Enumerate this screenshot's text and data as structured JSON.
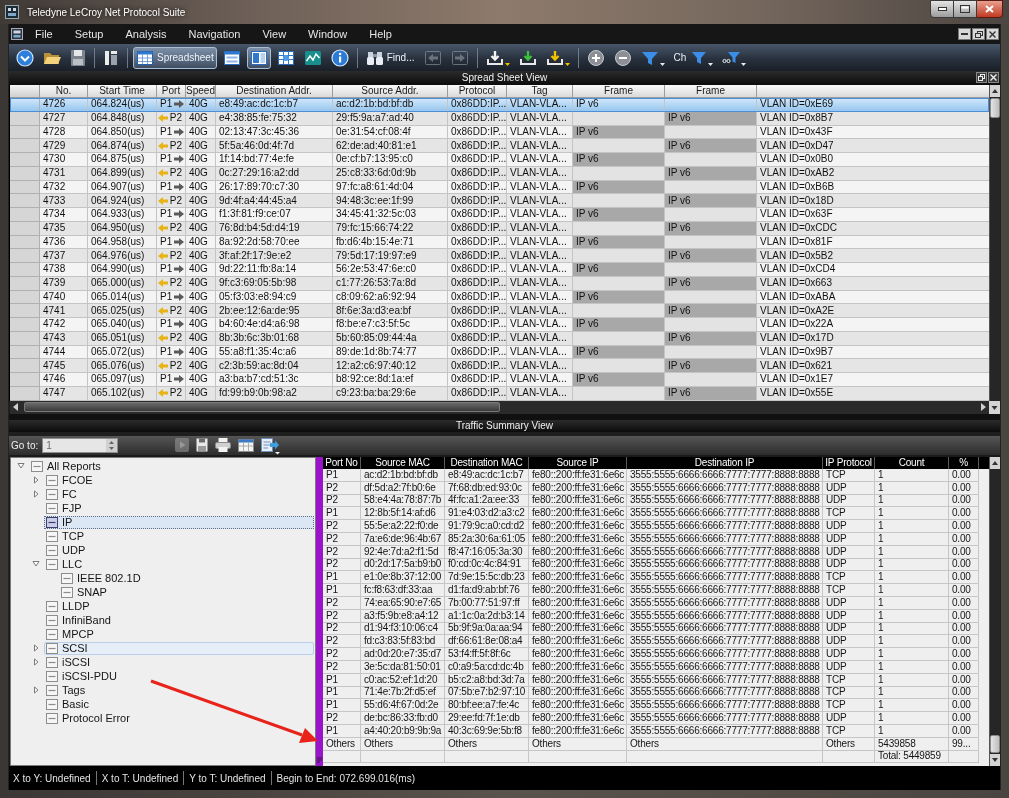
{
  "window": {
    "title": "Teledyne LeCroy Net Protocol Suite"
  },
  "menu": [
    "File",
    "Setup",
    "Analysis",
    "Navigation",
    "View",
    "Window",
    "Help"
  ],
  "toolbar": [
    {
      "items": [
        {
          "kind": "dropdown",
          "selected": false,
          "disabled": false
        },
        {
          "kind": "open",
          "selected": false,
          "disabled": false
        },
        {
          "kind": "save",
          "selected": false,
          "disabled": false
        }
      ]
    },
    {
      "items": [
        {
          "kind": "tools",
          "selected": false,
          "disabled": false
        }
      ]
    },
    {
      "items": [
        {
          "kind": "spreadsheet",
          "label": "Spreadsheet",
          "selected": true,
          "disabled": false
        },
        {
          "kind": "window",
          "selected": false,
          "disabled": false
        },
        {
          "kind": "split",
          "selected": true,
          "disabled": false
        },
        {
          "kind": "grid",
          "selected": false,
          "disabled": false
        },
        {
          "kind": "chart",
          "selected": false,
          "disabled": false
        },
        {
          "kind": "info",
          "selected": false,
          "disabled": false
        }
      ]
    },
    {
      "items": [
        {
          "kind": "find",
          "label": "Find...",
          "selected": false,
          "disabled": false
        },
        {
          "kind": "back",
          "selected": false,
          "disabled": true
        },
        {
          "kind": "forward",
          "selected": false,
          "disabled": true
        }
      ]
    },
    {
      "items": [
        {
          "kind": "export",
          "selected": false,
          "disabled": false
        },
        {
          "kind": "import",
          "selected": false,
          "disabled": false
        },
        {
          "kind": "mark",
          "selected": false,
          "disabled": false
        }
      ]
    },
    {
      "items": [
        {
          "kind": "zoomin",
          "selected": false,
          "disabled": false
        },
        {
          "kind": "zoomout",
          "selected": false,
          "disabled": false
        },
        {
          "kind": "filter",
          "selected": false,
          "disabled": false
        },
        {
          "kind": "labelfilter",
          "label": "Ch",
          "selected": false,
          "disabled": false
        },
        {
          "kind": "dotfilter",
          "selected": false,
          "disabled": false
        }
      ]
    }
  ],
  "spreadsheet": {
    "title": "Spread Sheet View",
    "columns": [
      "No.",
      "Start Time",
      "Port",
      "Speed",
      "Destination Addr.",
      "Source Addr.",
      "Protocol",
      "Tag",
      "Frame",
      "Frame"
    ],
    "rows": [
      {
        "no": "4726",
        "start_time": "064.824(us)",
        "port": "P1",
        "outbound": true,
        "speed": "40G",
        "destination": "e8:49:ac:dc:1c:b7",
        "source": "ac:d2:1b:bd:bf:db",
        "protocol": "0x86DD:IP...",
        "tag": "VLAN-VLA...",
        "frame_1": "IP v6",
        "column_12": "VLAN ID=0xE69",
        "selected": true
      },
      {
        "no": "4727",
        "start_time": "064.848(us)",
        "port": "P2",
        "outbound": false,
        "speed": "40G",
        "destination": "e4:38:85:fe:75:32",
        "source": "29:f5:9a:a7:ad:40",
        "protocol": "0x86DD:IP...",
        "tag": "VLAN-VLA...",
        "frame_2": "IP v6",
        "column_12": "VLAN ID=0x8B7",
        "selected": false
      },
      {
        "no": "4728",
        "start_time": "064.850(us)",
        "port": "P1",
        "outbound": true,
        "speed": "40G",
        "destination": "02:13:47:3c:45:36",
        "source": "0e:31:54:cf:08:4f",
        "protocol": "0x86DD:IP...",
        "tag": "VLAN-VLA...",
        "frame_1": "IP v6",
        "column_12": "VLAN ID=0x43F",
        "selected": false
      },
      {
        "no": "4729",
        "start_time": "064.874(us)",
        "port": "P2",
        "outbound": false,
        "speed": "40G",
        "destination": "5f:5a:46:0d:4f:7d",
        "source": "62:de:ad:40:81:e1",
        "protocol": "0x86DD:IP...",
        "tag": "VLAN-VLA...",
        "frame_2": "IP v6",
        "column_12": "VLAN ID=0xD47",
        "selected": false
      },
      {
        "no": "4730",
        "start_time": "064.875(us)",
        "port": "P1",
        "outbound": true,
        "speed": "40G",
        "destination": "1f:14:bd:77:4e:fe",
        "source": "0e:cf:b7:13:95:c0",
        "protocol": "0x86DD:IP...",
        "tag": "VLAN-VLA...",
        "frame_1": "IP v6",
        "column_12": "VLAN ID=0x0B0",
        "selected": false
      },
      {
        "no": "4731",
        "start_time": "064.899(us)",
        "port": "P2",
        "outbound": false,
        "speed": "40G",
        "destination": "0c:27:29:16:a2:dd",
        "source": "25:c8:33:6d:0d:9b",
        "protocol": "0x86DD:IP...",
        "tag": "VLAN-VLA...",
        "frame_2": "IP v6",
        "column_12": "VLAN ID=0xAB2",
        "selected": false
      },
      {
        "no": "4732",
        "start_time": "064.907(us)",
        "port": "P1",
        "outbound": true,
        "speed": "40G",
        "destination": "26:17:89:70:c7:30",
        "source": "97:fc:a8:61:4d:04",
        "protocol": "0x86DD:IP...",
        "tag": "VLAN-VLA...",
        "frame_1": "IP v6",
        "column_12": "VLAN ID=0xB6B",
        "selected": false
      },
      {
        "no": "4733",
        "start_time": "064.924(us)",
        "port": "P2",
        "outbound": false,
        "speed": "40G",
        "destination": "9d:4f:a4:44:45:a4",
        "source": "94:48:3c:ee:1f:99",
        "protocol": "0x86DD:IP...",
        "tag": "VLAN-VLA...",
        "frame_2": "IP v6",
        "column_12": "VLAN ID=0x18D",
        "selected": false
      },
      {
        "no": "4734",
        "start_time": "064.933(us)",
        "port": "P1",
        "outbound": true,
        "speed": "40G",
        "destination": "f1:3f:81:f9:ce:07",
        "source": "34:45:41:32:5c:03",
        "protocol": "0x86DD:IP...",
        "tag": "VLAN-VLA...",
        "frame_1": "IP v6",
        "column_12": "VLAN ID=0x63F",
        "selected": false
      },
      {
        "no": "4735",
        "start_time": "064.950(us)",
        "port": "P2",
        "outbound": false,
        "speed": "40G",
        "destination": "76:8d:b4:5d:d4:19",
        "source": "79:fc:15:66:74:22",
        "protocol": "0x86DD:IP...",
        "tag": "VLAN-VLA...",
        "frame_2": "IP v6",
        "column_12": "VLAN ID=0xCDC",
        "selected": false
      },
      {
        "no": "4736",
        "start_time": "064.958(us)",
        "port": "P1",
        "outbound": true,
        "speed": "40G",
        "destination": "8a:92:2d:58:70:ee",
        "source": "fb:d6:4b:15:4e:71",
        "protocol": "0x86DD:IP...",
        "tag": "VLAN-VLA...",
        "frame_1": "IP v6",
        "column_12": "VLAN ID=0x81F",
        "selected": false
      },
      {
        "no": "4737",
        "start_time": "064.976(us)",
        "port": "P2",
        "outbound": false,
        "speed": "40G",
        "destination": "3f:af:2f:17:9e:e2",
        "source": "79:5d:17:19:97:e9",
        "protocol": "0x86DD:IP...",
        "tag": "VLAN-VLA...",
        "frame_2": "IP v6",
        "column_12": "VLAN ID=0x5B2",
        "selected": false
      },
      {
        "no": "4738",
        "start_time": "064.990(us)",
        "port": "P1",
        "outbound": true,
        "speed": "40G",
        "destination": "9d:22:11:fb:8a:14",
        "source": "56:2e:53:47:6e:c0",
        "protocol": "0x86DD:IP...",
        "tag": "VLAN-VLA...",
        "frame_1": "IP v6",
        "column_12": "VLAN ID=0xCD4",
        "selected": false
      },
      {
        "no": "4739",
        "start_time": "065.000(us)",
        "port": "P2",
        "outbound": false,
        "speed": "40G",
        "destination": "9f:c3:69:05:5b:98",
        "source": "c1:77:26:53:7a:8d",
        "protocol": "0x86DD:IP...",
        "tag": "VLAN-VLA...",
        "frame_2": "IP v6",
        "column_12": "VLAN ID=0x663",
        "selected": false
      },
      {
        "no": "4740",
        "start_time": "065.014(us)",
        "port": "P1",
        "outbound": true,
        "speed": "40G",
        "destination": "05:f3:03:e8:94:c9",
        "source": "c8:09:62:a6:92:94",
        "protocol": "0x86DD:IP...",
        "tag": "VLAN-VLA...",
        "frame_1": "IP v6",
        "column_12": "VLAN ID=0xABA",
        "selected": false
      },
      {
        "no": "4741",
        "start_time": "065.025(us)",
        "port": "P2",
        "outbound": false,
        "speed": "40G",
        "destination": "2b:ee:12:6a:de:95",
        "source": "8f:6e:3a:d3:ea:bf",
        "protocol": "0x86DD:IP...",
        "tag": "VLAN-VLA...",
        "frame_2": "IP v6",
        "column_12": "VLAN ID=0xA2E",
        "selected": false
      },
      {
        "no": "4742",
        "start_time": "065.040(us)",
        "port": "P1",
        "outbound": true,
        "speed": "40G",
        "destination": "b4:60:4e:d4:a6:98",
        "source": "f8:be:e7:c3:5f:5c",
        "protocol": "0x86DD:IP...",
        "tag": "VLAN-VLA...",
        "frame_1": "IP v6",
        "column_12": "VLAN ID=0x22A",
        "selected": false
      },
      {
        "no": "4743",
        "start_time": "065.051(us)",
        "port": "P2",
        "outbound": false,
        "speed": "40G",
        "destination": "8b:3b:6c:3b:01:68",
        "source": "5b:60:85:09:44:4a",
        "protocol": "0x86DD:IP...",
        "tag": "VLAN-VLA...",
        "frame_2": "IP v6",
        "column_12": "VLAN ID=0x17D",
        "selected": false
      },
      {
        "no": "4744",
        "start_time": "065.072(us)",
        "port": "P1",
        "outbound": true,
        "speed": "40G",
        "destination": "55:a8:f1:35:4c:a6",
        "source": "89:de:1d:8b:74:77",
        "protocol": "0x86DD:IP...",
        "tag": "VLAN-VLA...",
        "frame_1": "IP v6",
        "column_12": "VLAN ID=0x9B7",
        "selected": false
      },
      {
        "no": "4745",
        "start_time": "065.076(us)",
        "port": "P2",
        "outbound": false,
        "speed": "40G",
        "destination": "c2:3b:59:ac:8d:04",
        "source": "12:a2:c6:97:40:12",
        "protocol": "0x86DD:IP...",
        "tag": "VLAN-VLA...",
        "frame_2": "IP v6",
        "column_12": "VLAN ID=0x621",
        "selected": false
      },
      {
        "no": "4746",
        "start_time": "065.097(us)",
        "port": "P1",
        "outbound": true,
        "speed": "40G",
        "destination": "a3:ba:b7:cd:51:3c",
        "source": "b8:92:ce:8d:1a:ef",
        "protocol": "0x86DD:IP...",
        "tag": "VLAN-VLA...",
        "frame_1": "IP v6",
        "column_12": "VLAN ID=0x1E7",
        "selected": false
      },
      {
        "no": "4747",
        "start_time": "065.102(us)",
        "port": "P2",
        "outbound": false,
        "speed": "40G",
        "destination": "fd:99:b9:0b:98:a2",
        "source": "c9:23:ba:ba:29:6e",
        "protocol": "0x86DD:IP...",
        "tag": "VLAN-VLA...",
        "frame_2": "IP v6",
        "column_12": "VLAN ID=0x55E",
        "selected": false
      }
    ]
  },
  "traffic_summary": {
    "title": "Traffic Summary View",
    "goto": {
      "label": "Go to:",
      "value": "1"
    },
    "toolbar": [
      {
        "kind": "run",
        "disabled": true
      },
      {
        "kind": "save",
        "disabled": false
      },
      {
        "kind": "print",
        "disabled": false
      },
      {
        "kind": "table",
        "disabled": false
      },
      {
        "kind": "export",
        "disabled": false
      }
    ],
    "tree": [
      {
        "label": "All Reports",
        "expanded": true,
        "selected": false,
        "hovered": false,
        "children": [
          {
            "label": "FCOE",
            "expanded": false,
            "selected": false,
            "hovered": false
          },
          {
            "label": "FC",
            "expanded": false,
            "selected": false,
            "hovered": false
          },
          {
            "label": "FJP",
            "selected": false,
            "hovered": false
          },
          {
            "label": "IP",
            "selected": true,
            "hovered": false
          },
          {
            "label": "TCP",
            "selected": false,
            "hovered": false
          },
          {
            "label": "UDP",
            "selected": false,
            "hovered": false
          },
          {
            "label": "LLC",
            "expanded": true,
            "selected": false,
            "hovered": false,
            "children": [
              {
                "label": "IEEE 802.1D",
                "selected": false,
                "hovered": false
              },
              {
                "label": "SNAP",
                "selected": false,
                "hovered": false
              }
            ]
          },
          {
            "label": "LLDP",
            "selected": false,
            "hovered": false
          },
          {
            "label": "InfiniBand",
            "selected": false,
            "hovered": false
          },
          {
            "label": "MPCP",
            "selected": false,
            "hovered": false
          },
          {
            "label": "SCSI",
            "expanded": false,
            "selected": false,
            "hovered": true
          },
          {
            "label": "iSCSI",
            "expanded": false,
            "selected": false,
            "hovered": false
          },
          {
            "label": "iSCSI-PDU",
            "selected": false,
            "hovered": false
          },
          {
            "label": "Tags",
            "expanded": false,
            "selected": false,
            "hovered": false
          },
          {
            "label": "Basic",
            "selected": false,
            "hovered": false
          },
          {
            "label": "Protocol Error",
            "selected": false,
            "hovered": false
          }
        ]
      }
    ],
    "table": {
      "columns": [
        "Port No",
        "Source MAC",
        "Destination MAC",
        "Source IP",
        "Destination IP",
        "IP Protocol",
        "Count",
        "%"
      ],
      "rows": [
        {
          "port_no": "P1",
          "source_mac": "ac:d2:1b:bd:bf:db",
          "destination_mac": "e8:49:ac:dc:1c:b7",
          "source_ip": "fe80::200:ff:fe31:6e6c",
          "destination_ip": "3555:5555:6666:6666:7777:7777:8888:8888",
          "ip_protocol": "TCP",
          "count": "1",
          "percent": "0.00"
        },
        {
          "port_no": "P2",
          "source_mac": "df:5d:a2:7f:b0:6e",
          "destination_mac": "7f:68:db:ed:93:0c",
          "source_ip": "fe80::200:ff:fe31:6e6c",
          "destination_ip": "3555:5555:6666:6666:7777:7777:8888:8888",
          "ip_protocol": "UDP",
          "count": "1",
          "percent": "0.00"
        },
        {
          "port_no": "P2",
          "source_mac": "58:e4:4a:78:87:7b",
          "destination_mac": "4f:fc:a1:2a:ee:33",
          "source_ip": "fe80::200:ff:fe31:6e6c",
          "destination_ip": "3555:5555:6666:6666:7777:7777:8888:8888",
          "ip_protocol": "UDP",
          "count": "1",
          "percent": "0.00"
        },
        {
          "port_no": "P1",
          "source_mac": "12:8b:5f:14:af:d6",
          "destination_mac": "91:e4:03:d2:a3:c2",
          "source_ip": "fe80::200:ff:fe31:6e6c",
          "destination_ip": "3555:5555:6666:6666:7777:7777:8888:8888",
          "ip_protocol": "TCP",
          "count": "1",
          "percent": "0.00"
        },
        {
          "port_no": "P2",
          "source_mac": "55:5e:a2:22:f0:de",
          "destination_mac": "91:79:9c:a0:cd:d2",
          "source_ip": "fe80::200:ff:fe31:6e6c",
          "destination_ip": "3555:5555:6666:6666:7777:7777:8888:8888",
          "ip_protocol": "UDP",
          "count": "1",
          "percent": "0.00"
        },
        {
          "port_no": "P2",
          "source_mac": "7a:e6:de:96:4b:67",
          "destination_mac": "85:2a:30:6a:61:05",
          "source_ip": "fe80::200:ff:fe31:6e6c",
          "destination_ip": "3555:5555:6666:6666:7777:7777:8888:8888",
          "ip_protocol": "UDP",
          "count": "1",
          "percent": "0.00"
        },
        {
          "port_no": "P2",
          "source_mac": "92:4e:7d:a2:f1:5d",
          "destination_mac": "f8:47:16:05:3a:30",
          "source_ip": "fe80::200:ff:fe31:6e6c",
          "destination_ip": "3555:5555:6666:6666:7777:7777:8888:8888",
          "ip_protocol": "UDP",
          "count": "1",
          "percent": "0.00"
        },
        {
          "port_no": "P2",
          "source_mac": "d0:2d:17:5a:b9:b0",
          "destination_mac": "f0:cd:0c:4c:84:91",
          "source_ip": "fe80::200:ff:fe31:6e6c",
          "destination_ip": "3555:5555:6666:6666:7777:7777:8888:8888",
          "ip_protocol": "UDP",
          "count": "1",
          "percent": "0.00"
        },
        {
          "port_no": "P1",
          "source_mac": "e1:0e:8b:37:12:00",
          "destination_mac": "7d:9e:15:5c:db:23",
          "source_ip": "fe80::200:ff:fe31:6e6c",
          "destination_ip": "3555:5555:6666:6666:7777:7777:8888:8888",
          "ip_protocol": "TCP",
          "count": "1",
          "percent": "0.00"
        },
        {
          "port_no": "P1",
          "source_mac": "fc:f8:63:df:33:aa",
          "destination_mac": "d1:fa:d9:ab:bf:76",
          "source_ip": "fe80::200:ff:fe31:6e6c",
          "destination_ip": "3555:5555:6666:6666:7777:7777:8888:8888",
          "ip_protocol": "TCP",
          "count": "1",
          "percent": "0.00"
        },
        {
          "port_no": "P2",
          "source_mac": "74:ea:65:90:e7:65",
          "destination_mac": "7b:00:77:51:97:ff",
          "source_ip": "fe80::200:ff:fe31:6e6c",
          "destination_ip": "3555:5555:6666:6666:7777:7777:8888:8888",
          "ip_protocol": "UDP",
          "count": "1",
          "percent": "0.00"
        },
        {
          "port_no": "P2",
          "source_mac": "a3:f5:9b:e8:a4:12",
          "destination_mac": "a1:1c:0a:2d:b3:14",
          "source_ip": "fe80::200:ff:fe31:6e6c",
          "destination_ip": "3555:5555:6666:6666:7777:7777:8888:8888",
          "ip_protocol": "UDP",
          "count": "1",
          "percent": "0.00"
        },
        {
          "port_no": "P2",
          "source_mac": "d1:94:f3:10:06:c4",
          "destination_mac": "5b:9f:9a:0a:aa:94",
          "source_ip": "fe80::200:ff:fe31:6e6c",
          "destination_ip": "3555:5555:6666:6666:7777:7777:8888:8888",
          "ip_protocol": "UDP",
          "count": "1",
          "percent": "0.00"
        },
        {
          "port_no": "P2",
          "source_mac": "fd:c3:83:5f:83:bd",
          "destination_mac": "df:66:61:8e:08:a4",
          "source_ip": "fe80::200:ff:fe31:6e6c",
          "destination_ip": "3555:5555:6666:6666:7777:7777:8888:8888",
          "ip_protocol": "UDP",
          "count": "1",
          "percent": "0.00"
        },
        {
          "port_no": "P2",
          "source_mac": "ad:0d:20:e7:35:d7",
          "destination_mac": "53:f4:ff:5f:8f:6c",
          "source_ip": "fe80::200:ff:fe31:6e6c",
          "destination_ip": "3555:5555:6666:6666:7777:7777:8888:8888",
          "ip_protocol": "UDP",
          "count": "1",
          "percent": "0.00"
        },
        {
          "port_no": "P2",
          "source_mac": "3e:5c:da:81:50:01",
          "destination_mac": "c0:a9:5a:cd:dc:4b",
          "source_ip": "fe80::200:ff:fe31:6e6c",
          "destination_ip": "3555:5555:6666:6666:7777:7777:8888:8888",
          "ip_protocol": "UDP",
          "count": "1",
          "percent": "0.00"
        },
        {
          "port_no": "P1",
          "source_mac": "c0:ac:52:ef:1d:20",
          "destination_mac": "b5:c2:a8:bd:3d:7a",
          "source_ip": "fe80::200:ff:fe31:6e6c",
          "destination_ip": "3555:5555:6666:6666:7777:7777:8888:8888",
          "ip_protocol": "TCP",
          "count": "1",
          "percent": "0.00"
        },
        {
          "port_no": "P1",
          "source_mac": "71:4e:7b:2f:d5:ef",
          "destination_mac": "07:5b:e7:b2:97:10",
          "source_ip": "fe80::200:ff:fe31:6e6c",
          "destination_ip": "3555:5555:6666:6666:7777:7777:8888:8888",
          "ip_protocol": "TCP",
          "count": "1",
          "percent": "0.00"
        },
        {
          "port_no": "P1",
          "source_mac": "55:d6:4f:67:0d:2e",
          "destination_mac": "80:bf:ee:a7:fe:4c",
          "source_ip": "fe80::200:ff:fe31:6e6c",
          "destination_ip": "3555:5555:6666:6666:7777:7777:8888:8888",
          "ip_protocol": "TCP",
          "count": "1",
          "percent": "0.00"
        },
        {
          "port_no": "P2",
          "source_mac": "de:bc:86:33:fb:d0",
          "destination_mac": "29:ee:fd:7f:1e:db",
          "source_ip": "fe80::200:ff:fe31:6e6c",
          "destination_ip": "3555:5555:6666:6666:7777:7777:8888:8888",
          "ip_protocol": "UDP",
          "count": "1",
          "percent": "0.00"
        },
        {
          "port_no": "P1",
          "source_mac": "a4:40:20:b9:9b:9a",
          "destination_mac": "40:3c:69:9e:5b:f8",
          "source_ip": "fe80::200:ff:fe31:6e6c",
          "destination_ip": "3555:5555:6666:6666:7777:7777:8888:8888",
          "ip_protocol": "TCP",
          "count": "1",
          "percent": "0.00"
        },
        {
          "port_no": "Others",
          "source_mac": "Others",
          "destination_mac": "Others",
          "source_ip": "Others",
          "destination_ip": "Others",
          "ip_protocol": "Others",
          "count": "5439858",
          "percent": "99..."
        }
      ],
      "total": {
        "count": "Total: 5449859"
      }
    }
  },
  "status_bar": [
    "X to Y: Undefined",
    "X to T: Undefined",
    "Y to T: Undefined",
    "Begin to End: 072.699.016(ms)"
  ]
}
